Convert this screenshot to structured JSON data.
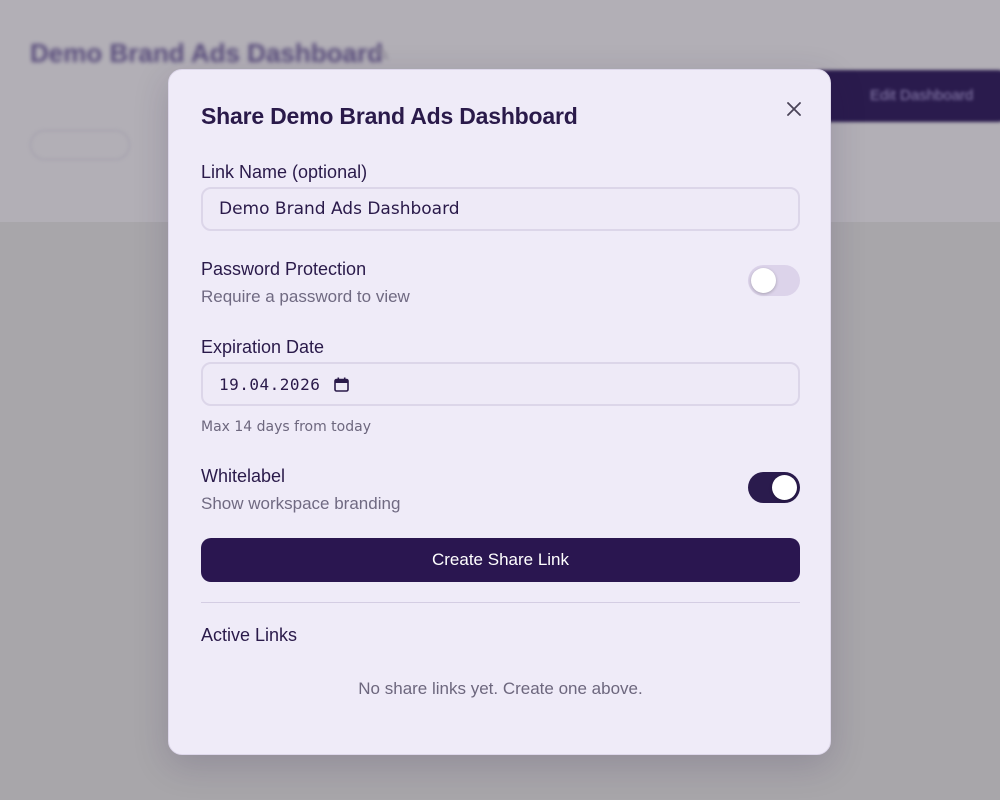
{
  "background": {
    "title": "Demo Brand Ads Dashboard",
    "edit_button_label": "Edit Dashboard",
    "edit_icon": "pencil-icon"
  },
  "dialog": {
    "title": "Share Demo Brand Ads Dashboard",
    "close_icon": "close-icon",
    "link_name": {
      "label": "Link Name (optional)",
      "value": "Demo Brand Ads Dashboard"
    },
    "password": {
      "label": "Password Protection",
      "description": "Require a password to view",
      "enabled": false
    },
    "expiration": {
      "label": "Expiration Date",
      "value": "19.04.2026",
      "icon": "calendar-icon",
      "hint": "Max 14 days from today"
    },
    "whitelabel": {
      "label": "Whitelabel",
      "description": "Show workspace branding",
      "enabled": true
    },
    "create_button_label": "Create Share Link",
    "active_links": {
      "title": "Active Links",
      "empty_text": "No share links yet. Create one above."
    }
  },
  "colors": {
    "primary": "#2a1650",
    "modal_bg": "#efebf8",
    "overlay": "#a8a6aa"
  }
}
